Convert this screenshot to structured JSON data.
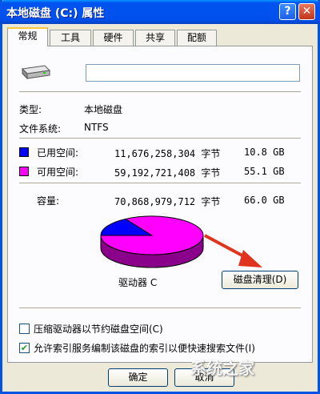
{
  "window": {
    "title": "本地磁盘 (C:) 属性",
    "help_label": "?",
    "close_label": "✕"
  },
  "tabs": [
    {
      "label": "常规",
      "active": true
    },
    {
      "label": "工具",
      "active": false
    },
    {
      "label": "硬件",
      "active": false
    },
    {
      "label": "共享",
      "active": false
    },
    {
      "label": "配额",
      "active": false
    }
  ],
  "general": {
    "drive_icon": "hard-drive-icon",
    "name_value": "",
    "type_label": "类型:",
    "type_value": "本地磁盘",
    "fs_label": "文件系统:",
    "fs_value": "NTFS",
    "used": {
      "label": "已用空间:",
      "bytes": "11,676,258,304 字节",
      "size": "10.8 GB",
      "color": "#0000ff"
    },
    "free": {
      "label": "可用空间:",
      "bytes": "59,192,721,408 字节",
      "size": "55.1 GB",
      "color": "#ff00ff"
    },
    "capacity": {
      "label": "容量:",
      "bytes": "70,868,979,712 字节",
      "size": "66.0 GB"
    },
    "drive_label": "驱动器 C",
    "cleanup_button": "磁盘清理(D)",
    "compress_label": "压缩驱动器以节约磁盘空间(C)",
    "compress_checked": false,
    "index_label": "允许索引服务编制该磁盘的索引以便快速搜索文件(I)",
    "index_checked": true
  },
  "buttons": {
    "ok": "确定",
    "cancel": "取消"
  },
  "watermark": "系统之家",
  "chart_data": {
    "type": "pie",
    "series": [
      {
        "name": "已用空间",
        "value": 10.8
      },
      {
        "name": "可用空间",
        "value": 55.1
      }
    ]
  }
}
